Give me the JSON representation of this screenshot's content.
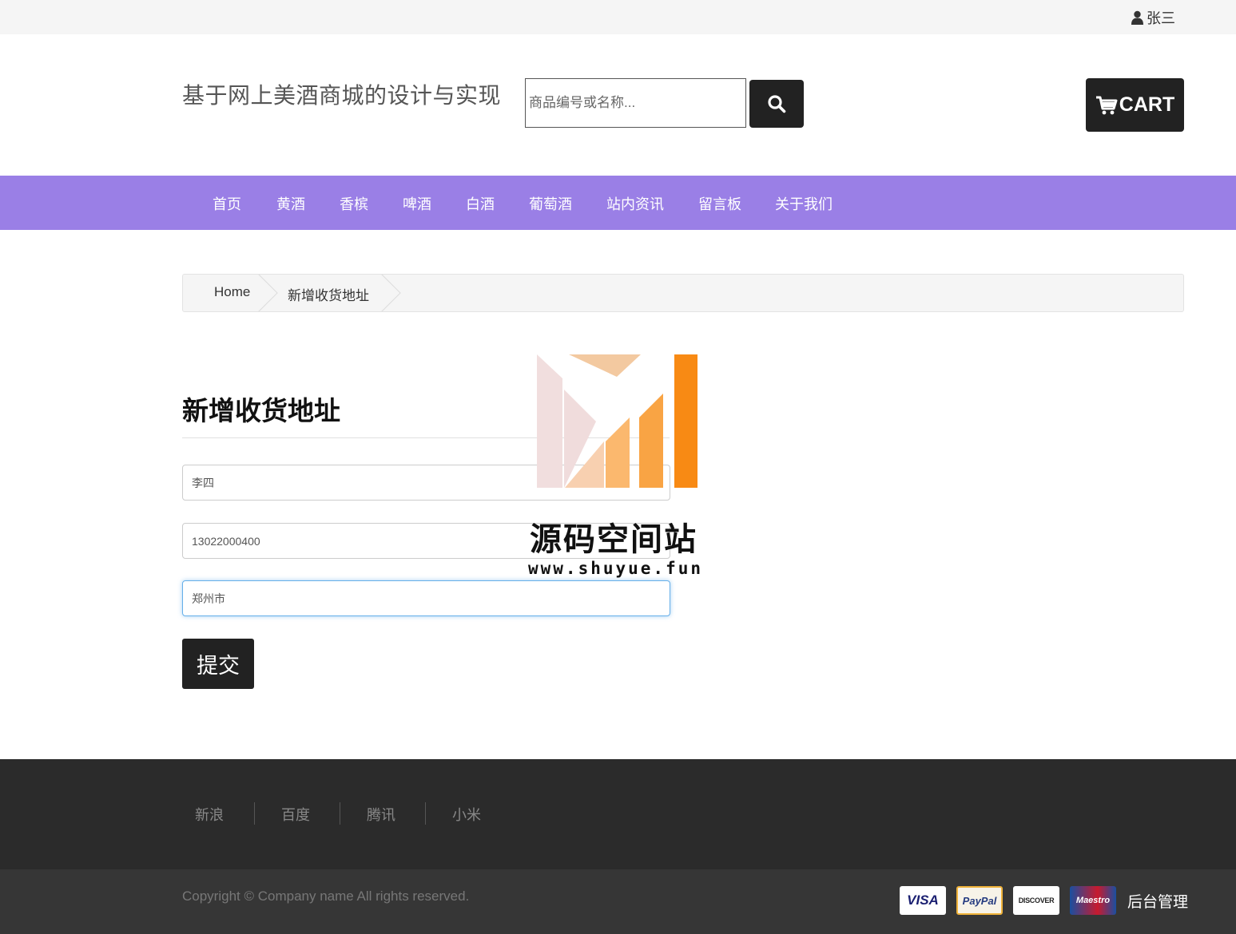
{
  "topbar": {
    "user_name": "张三",
    "user_icon": "user-icon"
  },
  "header": {
    "site_title": "基于网上美酒商城的设计与实现",
    "search_placeholder": "商品编号或名称...",
    "search_icon": "search-icon",
    "cart_label": "CART",
    "cart_icon": "cart-icon"
  },
  "nav": {
    "items": [
      "首页",
      "黄酒",
      "香槟",
      "啤酒",
      "白酒",
      "葡萄酒",
      "站内资讯",
      "留言板",
      "关于我们"
    ]
  },
  "breadcrumb": {
    "items": [
      "Home",
      "新增收货地址"
    ]
  },
  "form": {
    "heading": "新增收货地址",
    "name_value": "李四",
    "phone_value": "13022000400",
    "address_value": "郑州市",
    "submit_label": "提交"
  },
  "watermark": {
    "text": "源码空间站",
    "url": "www.shuyue.fun"
  },
  "footer": {
    "links": [
      "新浪",
      "百度",
      "腾讯",
      "小米"
    ],
    "copyright": "Copyright © Company name All rights reserved.",
    "payments": [
      "VISA",
      "PayPal",
      "DISCOVER",
      "Maestro"
    ],
    "admin_link": "后台管理"
  }
}
